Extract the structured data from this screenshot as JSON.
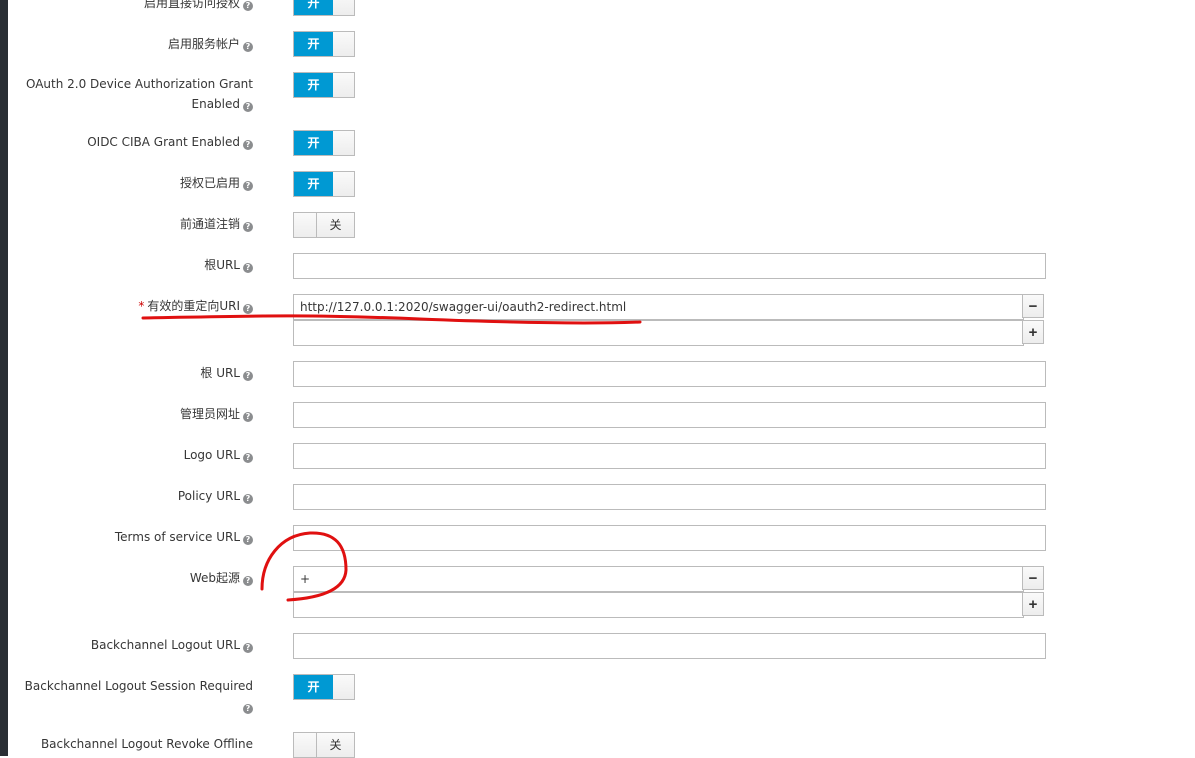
{
  "on_label": "开",
  "off_label": "关",
  "help_glyph": "?",
  "required_mark": "*",
  "rows": {
    "direct_access": {
      "label": "启用直接访问授权",
      "state": "on"
    },
    "service_accounts": {
      "label": "启用服务帐户",
      "state": "on"
    },
    "device_grant": {
      "label1": "OAuth 2.0 Device Authorization Grant",
      "label2": "Enabled",
      "state": "on"
    },
    "ciba": {
      "label": "OIDC CIBA Grant Enabled",
      "state": "on"
    },
    "authorization": {
      "label": "授权已启用",
      "state": "on"
    },
    "front_logout": {
      "label": "前通道注销",
      "state": "off"
    },
    "root_url": {
      "label": "根URL",
      "value": ""
    },
    "redirect_uri": {
      "label": "有效的重定向URI",
      "value": "http://127.0.0.1:2020/swagger-ui/oauth2-redirect.html",
      "new_value": "",
      "remove": "−",
      "add": "+"
    },
    "base_url": {
      "label": "根 URL",
      "value": ""
    },
    "admin_url": {
      "label": "管理员网址",
      "value": ""
    },
    "logo_url": {
      "label": "Logo URL",
      "value": ""
    },
    "policy_url": {
      "label": "Policy URL",
      "value": ""
    },
    "tos_url": {
      "label": "Terms of service URL",
      "value": ""
    },
    "web_origins": {
      "label": "Web起源",
      "value": "+",
      "new_value": "",
      "remove": "−",
      "add": "+"
    },
    "bc_logout_url": {
      "label": "Backchannel Logout URL",
      "value": ""
    },
    "bc_session": {
      "label": "Backchannel Logout Session Required",
      "state": "on"
    },
    "bc_revoke": {
      "label": "Backchannel Logout Revoke Offline",
      "state": "off"
    }
  },
  "annotation_color": "#e01010"
}
